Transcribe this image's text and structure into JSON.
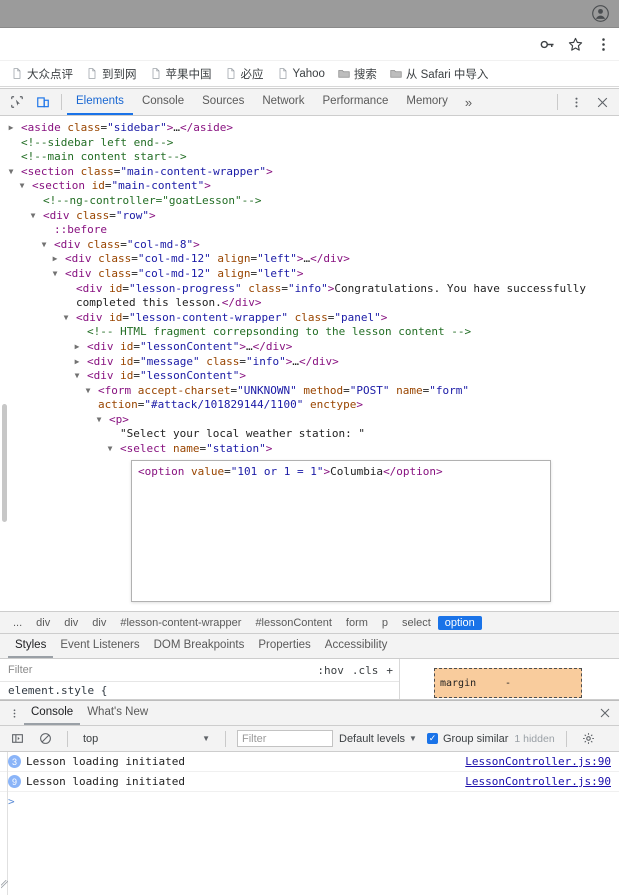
{
  "browser": {
    "profile_icon": "profile-icon",
    "toolbar_icons": [
      "key-icon",
      "star-icon",
      "kebab-menu-icon"
    ],
    "bookmarks": [
      {
        "label": "大众点评",
        "icon": "page-icon"
      },
      {
        "label": "到到网",
        "icon": "page-icon"
      },
      {
        "label": "苹果中国",
        "icon": "page-icon"
      },
      {
        "label": "必应",
        "icon": "page-icon"
      },
      {
        "label": "Yahoo",
        "icon": "page-icon"
      },
      {
        "label": "搜索",
        "icon": "folder-icon"
      },
      {
        "label": "从 Safari 中导入",
        "icon": "folder-icon"
      }
    ]
  },
  "devtools": {
    "inspect_icon": "inspect-cursor-icon",
    "device_icon": "device-toolbar-icon",
    "tabs": [
      {
        "label": "Elements",
        "active": true
      },
      {
        "label": "Console",
        "active": false
      },
      {
        "label": "Sources",
        "active": false
      },
      {
        "label": "Network",
        "active": false
      },
      {
        "label": "Performance",
        "active": false
      },
      {
        "label": "Memory",
        "active": false
      }
    ],
    "more_tabs_label": "»",
    "settings_icon": "kebab-menu-icon",
    "close_icon": "close-icon",
    "dom_lines": [
      {
        "indent": 1,
        "tri": "collapsed",
        "parts": [
          {
            "t": "tg",
            "v": "<aside "
          },
          {
            "t": "at",
            "v": "class"
          },
          {
            "t": "tx",
            "v": "="
          },
          {
            "t": "av",
            "v": "\"sidebar\""
          },
          {
            "t": "tg",
            "v": ">"
          },
          {
            "t": "tx",
            "v": "…"
          },
          {
            "t": "tg",
            "v": "</aside>"
          }
        ]
      },
      {
        "indent": 1,
        "tri": "none",
        "parts": [
          {
            "t": "cm",
            "v": "<!--sidebar left end-->"
          }
        ]
      },
      {
        "indent": 1,
        "tri": "none",
        "parts": [
          {
            "t": "cm",
            "v": "<!--main content start-->"
          }
        ]
      },
      {
        "indent": 1,
        "tri": "expanded",
        "parts": [
          {
            "t": "tg",
            "v": "<section "
          },
          {
            "t": "at",
            "v": "class"
          },
          {
            "t": "tx",
            "v": "="
          },
          {
            "t": "av",
            "v": "\"main-content-wrapper\""
          },
          {
            "t": "tg",
            "v": ">"
          }
        ]
      },
      {
        "indent": 2,
        "tri": "expanded",
        "parts": [
          {
            "t": "tg",
            "v": "<section "
          },
          {
            "t": "at",
            "v": "id"
          },
          {
            "t": "tx",
            "v": "="
          },
          {
            "t": "av",
            "v": "\"main-content\""
          },
          {
            "t": "tg",
            "v": ">"
          }
        ]
      },
      {
        "indent": 3,
        "tri": "none",
        "parts": [
          {
            "t": "cm",
            "v": "<!--ng-controller=\"goatLesson\"-->"
          }
        ]
      },
      {
        "indent": 3,
        "tri": "expanded",
        "parts": [
          {
            "t": "tg",
            "v": "<div "
          },
          {
            "t": "at",
            "v": "class"
          },
          {
            "t": "tx",
            "v": "="
          },
          {
            "t": "av",
            "v": "\"row\""
          },
          {
            "t": "tg",
            "v": ">"
          }
        ]
      },
      {
        "indent": 4,
        "tri": "none",
        "parts": [
          {
            "t": "pseudo",
            "v": "::before"
          }
        ]
      },
      {
        "indent": 4,
        "tri": "expanded",
        "parts": [
          {
            "t": "tg",
            "v": "<div "
          },
          {
            "t": "at",
            "v": "class"
          },
          {
            "t": "tx",
            "v": "="
          },
          {
            "t": "av",
            "v": "\"col-md-8\""
          },
          {
            "t": "tg",
            "v": ">"
          }
        ]
      },
      {
        "indent": 5,
        "tri": "collapsed",
        "parts": [
          {
            "t": "tg",
            "v": "<div "
          },
          {
            "t": "at",
            "v": "class"
          },
          {
            "t": "tx",
            "v": "="
          },
          {
            "t": "av",
            "v": "\"col-md-12\""
          },
          {
            "t": "tx",
            "v": " "
          },
          {
            "t": "at",
            "v": "align"
          },
          {
            "t": "tx",
            "v": "="
          },
          {
            "t": "av",
            "v": "\"left\""
          },
          {
            "t": "tg",
            "v": ">"
          },
          {
            "t": "tx",
            "v": "…"
          },
          {
            "t": "tg",
            "v": "</div>"
          }
        ]
      },
      {
        "indent": 5,
        "tri": "expanded",
        "parts": [
          {
            "t": "tg",
            "v": "<div "
          },
          {
            "t": "at",
            "v": "class"
          },
          {
            "t": "tx",
            "v": "="
          },
          {
            "t": "av",
            "v": "\"col-md-12\""
          },
          {
            "t": "tx",
            "v": " "
          },
          {
            "t": "at",
            "v": "align"
          },
          {
            "t": "tx",
            "v": "="
          },
          {
            "t": "av",
            "v": "\"left\""
          },
          {
            "t": "tg",
            "v": ">"
          }
        ]
      },
      {
        "indent": 6,
        "tri": "none",
        "parts": [
          {
            "t": "tg",
            "v": "<div "
          },
          {
            "t": "at",
            "v": "id"
          },
          {
            "t": "tx",
            "v": "="
          },
          {
            "t": "av",
            "v": "\"lesson-progress\""
          },
          {
            "t": "tx",
            "v": " "
          },
          {
            "t": "at",
            "v": "class"
          },
          {
            "t": "tx",
            "v": "="
          },
          {
            "t": "av",
            "v": "\"info\""
          },
          {
            "t": "tg",
            "v": ">"
          },
          {
            "t": "tx",
            "v": "Congratulations. You have successfully completed this lesson."
          },
          {
            "t": "tg",
            "v": "</div>"
          }
        ]
      },
      {
        "indent": 6,
        "tri": "expanded",
        "parts": [
          {
            "t": "tg",
            "v": "<div "
          },
          {
            "t": "at",
            "v": "id"
          },
          {
            "t": "tx",
            "v": "="
          },
          {
            "t": "av",
            "v": "\"lesson-content-wrapper\""
          },
          {
            "t": "tx",
            "v": " "
          },
          {
            "t": "at",
            "v": "class"
          },
          {
            "t": "tx",
            "v": "="
          },
          {
            "t": "av",
            "v": "\"panel\""
          },
          {
            "t": "tg",
            "v": ">"
          }
        ]
      },
      {
        "indent": 7,
        "tri": "none",
        "parts": [
          {
            "t": "cm",
            "v": "<!-- HTML fragment correpsonding to the lesson content -->"
          }
        ]
      },
      {
        "indent": 7,
        "tri": "collapsed",
        "parts": [
          {
            "t": "tg",
            "v": "<div "
          },
          {
            "t": "at",
            "v": "id"
          },
          {
            "t": "tx",
            "v": "="
          },
          {
            "t": "av",
            "v": "\"lessonContent\""
          },
          {
            "t": "tg",
            "v": ">"
          },
          {
            "t": "tx",
            "v": "…"
          },
          {
            "t": "tg",
            "v": "</div>"
          }
        ]
      },
      {
        "indent": 7,
        "tri": "collapsed",
        "parts": [
          {
            "t": "tg",
            "v": "<div "
          },
          {
            "t": "at",
            "v": "id"
          },
          {
            "t": "tx",
            "v": "="
          },
          {
            "t": "av",
            "v": "\"message\""
          },
          {
            "t": "tx",
            "v": " "
          },
          {
            "t": "at",
            "v": "class"
          },
          {
            "t": "tx",
            "v": "="
          },
          {
            "t": "av",
            "v": "\"info\""
          },
          {
            "t": "tg",
            "v": ">"
          },
          {
            "t": "tx",
            "v": "…"
          },
          {
            "t": "tg",
            "v": "</div>"
          }
        ]
      },
      {
        "indent": 7,
        "tri": "expanded",
        "parts": [
          {
            "t": "tg",
            "v": "<div "
          },
          {
            "t": "at",
            "v": "id"
          },
          {
            "t": "tx",
            "v": "="
          },
          {
            "t": "av",
            "v": "\"lessonContent\""
          },
          {
            "t": "tg",
            "v": ">"
          }
        ]
      },
      {
        "indent": 8,
        "tri": "expanded",
        "parts": [
          {
            "t": "tg",
            "v": "<form "
          },
          {
            "t": "at",
            "v": "accept-charset"
          },
          {
            "t": "tx",
            "v": "="
          },
          {
            "t": "av",
            "v": "\"UNKNOWN\""
          },
          {
            "t": "tx",
            "v": " "
          },
          {
            "t": "at",
            "v": "method"
          },
          {
            "t": "tx",
            "v": "="
          },
          {
            "t": "av",
            "v": "\"POST\""
          },
          {
            "t": "tx",
            "v": " "
          },
          {
            "t": "at",
            "v": "name"
          },
          {
            "t": "tx",
            "v": "="
          },
          {
            "t": "av",
            "v": "\"form\""
          },
          {
            "t": "tx",
            "v": " "
          },
          {
            "t": "at",
            "v": "action"
          },
          {
            "t": "tx",
            "v": "="
          },
          {
            "t": "av",
            "v": "\"#attack/101829144/1100\""
          },
          {
            "t": "tx",
            "v": " "
          },
          {
            "t": "at",
            "v": "enctype"
          },
          {
            "t": "tg",
            "v": ">"
          }
        ]
      },
      {
        "indent": 9,
        "tri": "expanded",
        "parts": [
          {
            "t": "tg",
            "v": "<p>"
          }
        ]
      },
      {
        "indent": 10,
        "tri": "none",
        "parts": [
          {
            "t": "tx",
            "v": "\"Select your local weather station: \""
          }
        ]
      },
      {
        "indent": 10,
        "tri": "expanded",
        "parts": [
          {
            "t": "tg",
            "v": "<select "
          },
          {
            "t": "at",
            "v": "name"
          },
          {
            "t": "tx",
            "v": "="
          },
          {
            "t": "av",
            "v": "\"station\""
          },
          {
            "t": "tg",
            "v": ">"
          }
        ]
      }
    ],
    "edit_line": [
      {
        "t": "tg",
        "v": "<option "
      },
      {
        "t": "at",
        "v": "value"
      },
      {
        "t": "tx",
        "v": "="
      },
      {
        "t": "av",
        "v": "\"101 or 1 = 1\""
      },
      {
        "t": "tg",
        "v": ">"
      },
      {
        "t": "tx",
        "v": "Columbia"
      },
      {
        "t": "tg",
        "v": "</option>"
      }
    ],
    "breadcrumbs": [
      {
        "label": "...",
        "selected": false
      },
      {
        "label": "div",
        "selected": false
      },
      {
        "label": "div",
        "selected": false
      },
      {
        "label": "div",
        "selected": false
      },
      {
        "label": "#lesson-content-wrapper",
        "selected": false
      },
      {
        "label": "#lessonContent",
        "selected": false
      },
      {
        "label": "form",
        "selected": false
      },
      {
        "label": "p",
        "selected": false
      },
      {
        "label": "select",
        "selected": false
      },
      {
        "label": "option",
        "selected": true
      }
    ],
    "style_tabs": [
      {
        "label": "Styles",
        "active": true
      },
      {
        "label": "Event Listeners",
        "active": false
      },
      {
        "label": "DOM Breakpoints",
        "active": false
      },
      {
        "label": "Properties",
        "active": false
      },
      {
        "label": "Accessibility",
        "active": false
      }
    ],
    "styles": {
      "filter_placeholder": "Filter",
      "hov_label": ":hov",
      "cls_label": ".cls",
      "plus_label": "+",
      "element_style": "element.style {",
      "metrics": {
        "label": "margin",
        "value": "-"
      },
      "margin_color": "#f9cc9d"
    }
  },
  "drawer": {
    "menu_icon": "kebab-menu-icon",
    "tabs": [
      {
        "label": "Console",
        "active": true
      },
      {
        "label": "What's New",
        "active": false
      }
    ],
    "close_icon": "close-icon",
    "toolbar": {
      "sidebar_icon": "console-sidebar-icon",
      "clear_icon": "clear-console-icon",
      "context": "top",
      "filter_placeholder": "Filter",
      "levels_label": "Default levels",
      "group_similar_label": "Group similar",
      "group_similar_checked": true,
      "hidden_label": "1 hidden",
      "settings_icon": "gear-icon"
    },
    "messages": [
      {
        "count": "3",
        "text": "Lesson loading initiated",
        "source": "LessonController.js:90"
      },
      {
        "count": "9",
        "text": "Lesson loading initiated",
        "source": "LessonController.js:90"
      }
    ],
    "prompt": ">"
  },
  "colors": {
    "accent": "#1a73e8",
    "tag": "#881280",
    "attr_name": "#994500",
    "attr_value": "#1a1aa6",
    "comment": "#236e25",
    "link": "#1a0dab",
    "margin_box": "#f9cc9d"
  }
}
